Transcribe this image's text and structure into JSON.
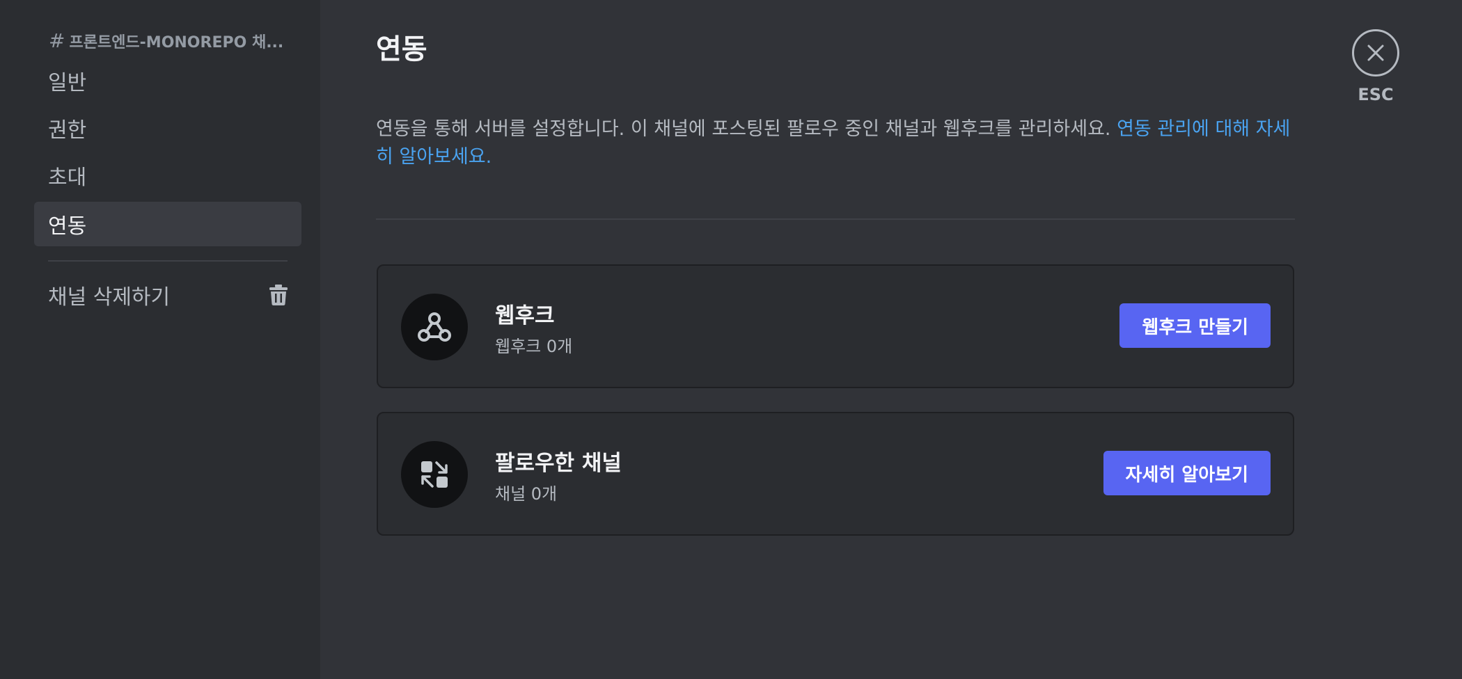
{
  "sidebar": {
    "header": "프론트엔드-MONOREPO 채...",
    "items": [
      {
        "label": "일반"
      },
      {
        "label": "권한"
      },
      {
        "label": "초대"
      },
      {
        "label": "연동"
      }
    ],
    "delete_label": "채널 삭제하기"
  },
  "main": {
    "title": "연동",
    "description": "연동을 통해 서버를 설정합니다. 이 채널에 포스팅된 팔로우 중인 채널과 웹후크를 관리하세요. ",
    "description_link": "연동 관리에 대해 자세히 알아보세요.",
    "cards": [
      {
        "title": "웹후크",
        "subtitle": "웹후크 0개",
        "button": "웹후크 만들기",
        "icon": "webhook-icon"
      },
      {
        "title": "팔로우한 채널",
        "subtitle": "채널 0개",
        "button": "자세히 알아보기",
        "icon": "followed-channel-icon"
      }
    ]
  },
  "close": {
    "label": "ESC"
  },
  "colors": {
    "background": "#313338",
    "sidebar": "#2b2d31",
    "accent": "#5865f2",
    "link": "#4aa3f0"
  }
}
